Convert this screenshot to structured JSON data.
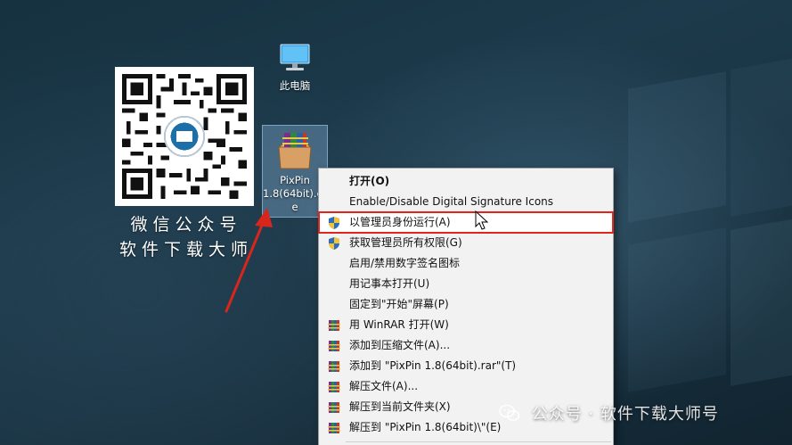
{
  "desktop": {
    "qr_caption": {
      "line1": "微信公众号",
      "line2": "软件下载大师"
    },
    "icons": [
      {
        "label": "此电脑",
        "icon": "computer-icon"
      },
      {
        "label_line1": "PixPin",
        "label_line2": "1.8(64bit).ex",
        "label_line3": "e",
        "icon": "winrar-archive-icon"
      }
    ]
  },
  "context_menu": {
    "items": [
      {
        "label": "打开(O)",
        "icon": "none",
        "bold": true
      },
      {
        "label": "Enable/Disable Digital Signature Icons",
        "icon": "none"
      },
      {
        "label": "以管理员身份运行(A)",
        "icon": "uac-shield-icon",
        "highlighted": true
      },
      {
        "label": "获取管理员所有权限(G)",
        "icon": "uac-shield-icon"
      },
      {
        "label": "启用/禁用数字签名图标",
        "icon": "none"
      },
      {
        "label": "用记事本打开(U)",
        "icon": "none"
      },
      {
        "label": "固定到\"开始\"屏幕(P)",
        "icon": "none"
      },
      {
        "label": "用 WinRAR 打开(W)",
        "icon": "winrar-icon"
      },
      {
        "label": "添加到压缩文件(A)...",
        "icon": "winrar-icon"
      },
      {
        "label": "添加到 \"PixPin 1.8(64bit).rar\"(T)",
        "icon": "winrar-icon"
      },
      {
        "label": "解压文件(A)...",
        "icon": "winrar-icon"
      },
      {
        "label": "解压到当前文件夹(X)",
        "icon": "winrar-icon"
      },
      {
        "label": "解压到 \"PixPin 1.8(64bit)\\\"(E)",
        "icon": "winrar-icon"
      }
    ]
  },
  "watermark": {
    "text": "公众号 · 软件下载大师号"
  },
  "colors": {
    "highlight_outline": "#e0261c",
    "arrow": "#d9261c",
    "menu_background": "#f2f2f2",
    "selection_box": "#9cc4ec"
  }
}
